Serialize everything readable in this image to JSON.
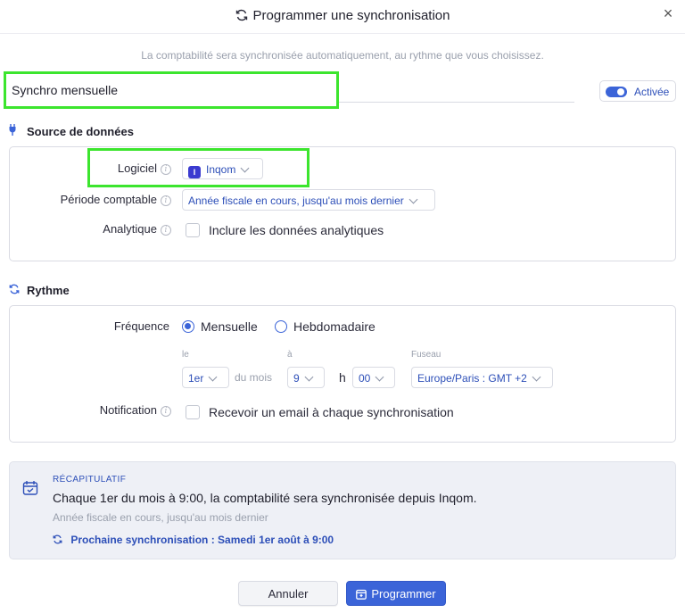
{
  "dialog": {
    "title": "Programmer une synchronisation",
    "close_label": "×",
    "subtitle": "La comptabilité sera synchronisée automatiquement, au rythme que vous choisissez."
  },
  "name": {
    "value": "Synchro mensuelle"
  },
  "toggle": {
    "label": "Activée",
    "on": true
  },
  "source": {
    "title": "Source de données",
    "logiciel": {
      "label": "Logiciel",
      "value": "Inqom"
    },
    "periode": {
      "label": "Période comptable",
      "value": "Année fiscale en cours, jusqu'au mois dernier"
    },
    "analytique": {
      "label": "Analytique",
      "checkbox_label": "Inclure les données analytiques",
      "checked": false
    }
  },
  "rythme": {
    "title": "Rythme",
    "frequence": {
      "label": "Fréquence",
      "options": [
        "Mensuelle",
        "Hebdomadaire"
      ],
      "selected": "Mensuelle"
    },
    "le": {
      "label": "le",
      "value": "1er",
      "suffix": "du mois"
    },
    "a": {
      "label": "à",
      "hour": "9",
      "h_sep": "h",
      "minutes": "00"
    },
    "fuseau": {
      "label": "Fuseau",
      "value": "Europe/Paris : GMT +2"
    },
    "notification": {
      "label": "Notification",
      "checkbox_label": "Recevoir un email à chaque synchronisation",
      "checked": false
    }
  },
  "summary": {
    "heading": "RÉCAPITULATIF",
    "main": "Chaque 1er du mois à 9:00, la comptabilité sera synchronisée depuis Inqom.",
    "sub": "Année fiscale en cours, jusqu'au mois dernier",
    "next": "Prochaine synchronisation : Samedi 1er août à 9:00"
  },
  "buttons": {
    "cancel": "Annuler",
    "submit": "Programmer"
  },
  "colors": {
    "accent": "#3b64d8",
    "highlight": "#3ce52e",
    "summary_bg": "#eef0f6"
  },
  "icons": {
    "title": "sync-icon",
    "close": "close-icon",
    "source": "plug-icon",
    "rythme": "sync-icon",
    "logiciel": "inqom-logo-icon",
    "summary": "calendar-check-icon",
    "submit": "schedule-icon"
  }
}
